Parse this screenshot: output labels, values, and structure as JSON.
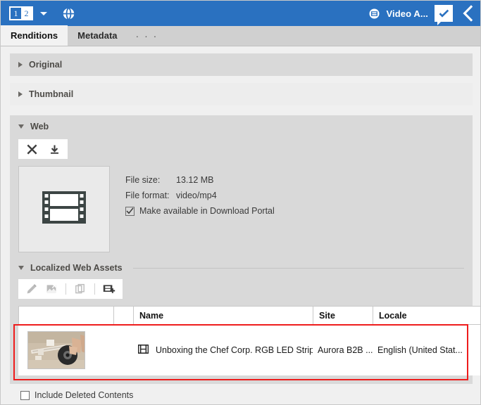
{
  "topbar": {
    "page_badge": {
      "left": "1",
      "right": "2",
      "active": "right"
    },
    "dropdown_icon": "chevron-down-icon",
    "globe_icon": "globe-icon",
    "asset_type_icon": "film-icon",
    "asset_title": "Video A...",
    "approve_icon": "comment-check-icon",
    "back_icon": "chevron-left-icon",
    "accent_color": "#2a71c0"
  },
  "tabs": [
    {
      "label": "Renditions",
      "active": true
    },
    {
      "label": "Metadata",
      "active": false
    }
  ],
  "tab_overflow": "· · ·",
  "sections": [
    {
      "label": "Original",
      "expanded": false
    },
    {
      "label": "Thumbnail",
      "expanded": false
    }
  ],
  "web": {
    "label": "Web",
    "expanded": true,
    "toolbar": [
      {
        "name": "delete-rendition-button",
        "icon": "close-x-icon"
      },
      {
        "name": "download-rendition-button",
        "icon": "download-icon"
      }
    ],
    "preview_icon": "film-strip-icon",
    "file_size_label": "File size:",
    "file_size_value": "13.12 MB",
    "file_format_label": "File format:",
    "file_format_value": "video/mp4",
    "download_portal_label": "Make available in Download Portal",
    "download_portal_checked": true
  },
  "localized": {
    "label": "Localized Web Assets",
    "expanded": true,
    "toolbar": [
      {
        "name": "edit-button",
        "icon": "pencil-icon",
        "disabled": true
      },
      {
        "name": "replace-image-button",
        "icon": "image-export-icon",
        "disabled": true
      },
      {
        "name": "copy-button",
        "icon": "copy-icon",
        "disabled": true
      },
      {
        "name": "add-video-button",
        "icon": "film-plus-icon",
        "disabled": false
      }
    ],
    "table": {
      "columns": [
        "",
        "",
        "Name",
        "Site",
        "Locale",
        ""
      ],
      "rows": [
        {
          "thumbnail": "led-strip-unboxing-thumbnail",
          "type_icon": "film-icon",
          "name": "Unboxing the Chef Corp. RGB LED Strips Vid...",
          "site": "Aurora B2B ...",
          "locale": "English (United Stat...",
          "action_icon": "pencil-icon"
        }
      ]
    }
  },
  "footer": {
    "include_deleted_label": "Include Deleted Contents",
    "include_deleted_checked": false
  },
  "annotation": {
    "highlight_color": "#ee1c1c"
  }
}
